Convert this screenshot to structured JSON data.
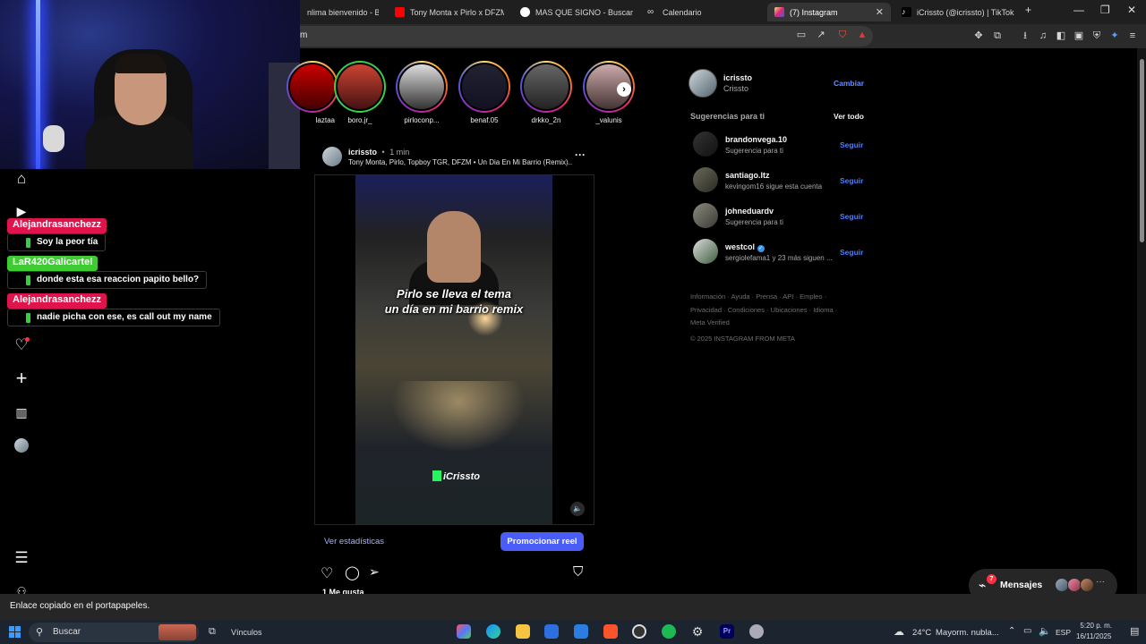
{
  "browser": {
    "tabs": [
      {
        "label": "nlima bienvenido - Busca",
        "icon": "google-icon"
      },
      {
        "label": "Tony Monta x Pirlo x DFZM x T",
        "icon": "youtube-icon"
      },
      {
        "label": "MAS QUE SIGNO - Buscar con",
        "icon": "google-icon"
      },
      {
        "label": "Calendario",
        "icon": "link-icon"
      },
      {
        "label": "(7) Instagram",
        "icon": "instagram-icon",
        "active": true
      },
      {
        "label": "iCrissto (@icrissto) | TikTok",
        "icon": "tiktok-icon"
      }
    ],
    "new_tab": "+",
    "omnibox_text": "m"
  },
  "chat": {
    "messages": [
      {
        "user": "Alejandrasanchezz",
        "text": "Soy la peor tía",
        "color": "#e0144c"
      },
      {
        "user": "LaR420Galicartel",
        "text": "donde esta esa reaccion papito bello?",
        "color": "#3fcc32"
      },
      {
        "user": "Alejandrasanchezz",
        "text": "nadie picha con ese, es call out my name",
        "color": "#e0144c"
      }
    ]
  },
  "stories": [
    {
      "name": "laztaa"
    },
    {
      "name": "boro.jr_"
    },
    {
      "name": "pirloconp..."
    },
    {
      "name": "benaf.05"
    },
    {
      "name": "drkko_2n"
    },
    {
      "name": "_valunis"
    }
  ],
  "post": {
    "username": "icrissto",
    "time_sep": "•",
    "time": "1 min",
    "audio": "Tony Monta, Pirlo, Topboy TGR, DFZM • Un Dia En Mi Barrio (Remix)...",
    "caption_line1": "Pirlo se lleva el tema",
    "caption_line2": "un día en mi barrio remix",
    "watermark": "iCrissto",
    "stats_link": "Ver estadísticas",
    "promote_button": "Promocionar reel",
    "likes": "1 Me gusta"
  },
  "sidebar": {
    "account_username": "icrissto",
    "account_name": "Crissto",
    "switch_label": "Cambiar",
    "suggestions_title": "Sugerencias para ti",
    "see_all": "Ver todo",
    "suggestions": [
      {
        "username": "brandonvega.10",
        "sub": "Sugerencia para ti",
        "follow": "Seguir",
        "verified": false
      },
      {
        "username": "santiago.ltz",
        "sub": "kevingom16 sigue esta cuenta",
        "follow": "Seguir",
        "verified": false
      },
      {
        "username": "johneduardv",
        "sub": "Sugerencia para ti",
        "follow": "Seguir",
        "verified": false
      },
      {
        "username": "westcol",
        "sub": "sergiolefama1 y 23 más siguen ...",
        "follow": "Seguir",
        "verified": true
      }
    ],
    "footer_line1": [
      "Información",
      "Ayuda",
      "Prensa",
      "API",
      "Empleo"
    ],
    "footer_line2": [
      "Privacidad",
      "Condiciones",
      "Ubicaciones",
      "Idioma"
    ],
    "footer_line3": [
      "Meta Verified"
    ],
    "copyright": "© 2025 INSTAGRAM FROM META"
  },
  "messages_pill": {
    "label": "Mensajes",
    "badge": "7"
  },
  "toast": "Enlace copiado en el portapapeles.",
  "taskbar": {
    "search_placeholder": "Buscar",
    "links_label": "Vínculos",
    "weather_temp": "24°C",
    "weather_desc": "Mayorm. nubla...",
    "lang": "ESP",
    "time": "5:20 p. m.",
    "date": "16/11/2025"
  }
}
